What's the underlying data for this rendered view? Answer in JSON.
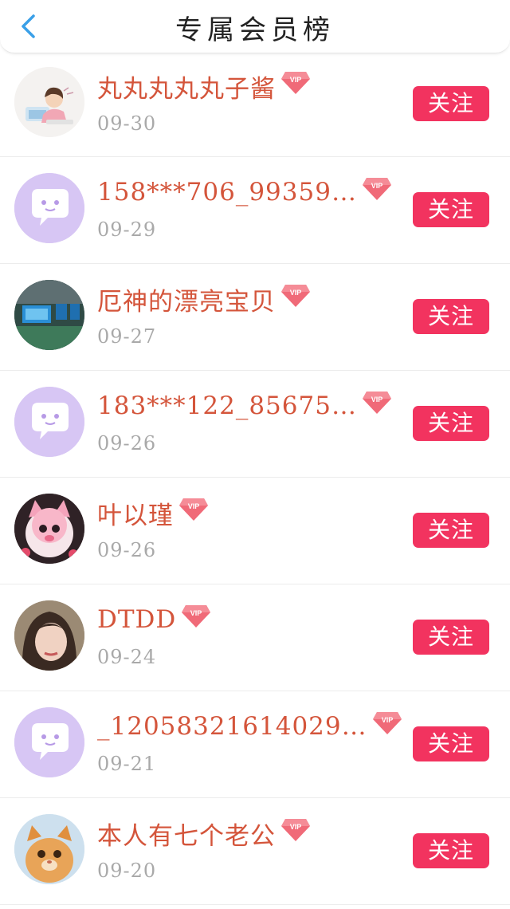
{
  "header": {
    "title": "专属会员榜"
  },
  "icons": {
    "back": "chevron-left-icon",
    "vip": "vip-diamond-icon"
  },
  "colors": {
    "accent_blue": "#3aa0e8",
    "name_red": "#d4553b",
    "follow_bg": "#f2335f",
    "date_gray": "#a9a9a9"
  },
  "follow_label": "关注",
  "vip_label": "VIP",
  "members": [
    {
      "name": "丸丸丸丸丸子酱",
      "date": "09-30",
      "avatar": "cartoon-girl"
    },
    {
      "name": "158***706_99359…",
      "date": "09-29",
      "avatar": "default-chat"
    },
    {
      "name": "厄神的漂亮宝贝",
      "date": "09-27",
      "avatar": "room-screen"
    },
    {
      "name": "183***122_85675…",
      "date": "09-26",
      "avatar": "default-chat"
    },
    {
      "name": "叶以瑾",
      "date": "09-26",
      "avatar": "pink-fox"
    },
    {
      "name": "DTDD",
      "date": "09-24",
      "avatar": "woman-portrait"
    },
    {
      "name": "_12058321614029…",
      "date": "09-21",
      "avatar": "default-chat"
    },
    {
      "name": "本人有七个老公",
      "date": "09-20",
      "avatar": "orange-cat"
    }
  ]
}
